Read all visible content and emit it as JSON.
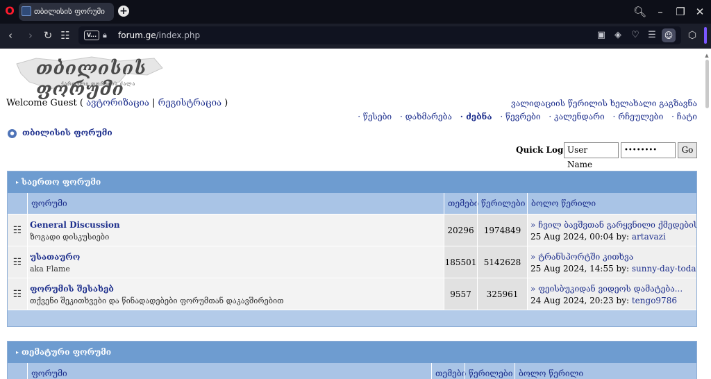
{
  "browser": {
    "tab_title": "თბილისის ფორუმი",
    "url_domain": "forum.ge",
    "url_path": "/index.php",
    "site_badge": "V..."
  },
  "logo": {
    "title": "თბილისის ფორუმი",
    "subtitle": "ქართული ფორუმის ძალა"
  },
  "header": {
    "welcome_prefix": "Welcome Guest ( ",
    "login_link": "ავტორიზაცია",
    "separator": " | ",
    "register_link": "რეგისტრაცია",
    "welcome_suffix": " )",
    "validation_link": "ვალიდაციის წერილის ხელახალი გაგზავნა",
    "nav": [
      {
        "label": "წესები"
      },
      {
        "label": "დახმარება"
      },
      {
        "label": "ძებნა"
      },
      {
        "label": "წევრები"
      },
      {
        "label": "კალენდარი"
      },
      {
        "label": "რჩეულები"
      },
      {
        "label": "ჩატი"
      }
    ],
    "breadcrumb": "თბილისის ფორუმი"
  },
  "quick_login": {
    "label": "Quick Log In",
    "username_value": "User Name",
    "password_value": "••••••••",
    "go_label": "Go"
  },
  "categories": [
    {
      "title": "საერთო ფორუმი",
      "columns": {
        "forum": "ფორუმი",
        "topics": "თემები",
        "posts": "წერილები",
        "last": "ბოლო წერილი"
      },
      "forums": [
        {
          "name": "General Discussion",
          "desc": "ზოგადი დისკუსიები",
          "topics": "20296",
          "posts": "1974849",
          "last_title": "» ჩვილ ბავშვთან გარყვნილი ქმედების...",
          "last_date": "25 Aug 2024, 00:04 by: ",
          "last_user": "artavazi"
        },
        {
          "name": "უსათაურო",
          "desc": "aka Flame",
          "topics": "185501",
          "posts": "5142628",
          "last_title": "» ტრანსპორტში კითხვა",
          "last_date": "25 Aug 2024, 14:55 by: ",
          "last_user": "sunny-day-today"
        },
        {
          "name": "ფორუმის შესახებ",
          "desc": "თქვენი შეკითხვები და წინადადებები ფორუმთან დაკავშირებით",
          "topics": "9557",
          "posts": "325961",
          "last_title": "» ფეისბუკიდან ვიდეოს დამატება...",
          "last_date": "24 Aug 2024, 20:23 by: ",
          "last_user": "tengo9786"
        }
      ]
    },
    {
      "title": "თემატური ფორუმი",
      "columns": {
        "forum": "ფორუმი",
        "topics": "თემები",
        "posts": "წერილები",
        "last": "ბოლო წერილი"
      }
    }
  ]
}
